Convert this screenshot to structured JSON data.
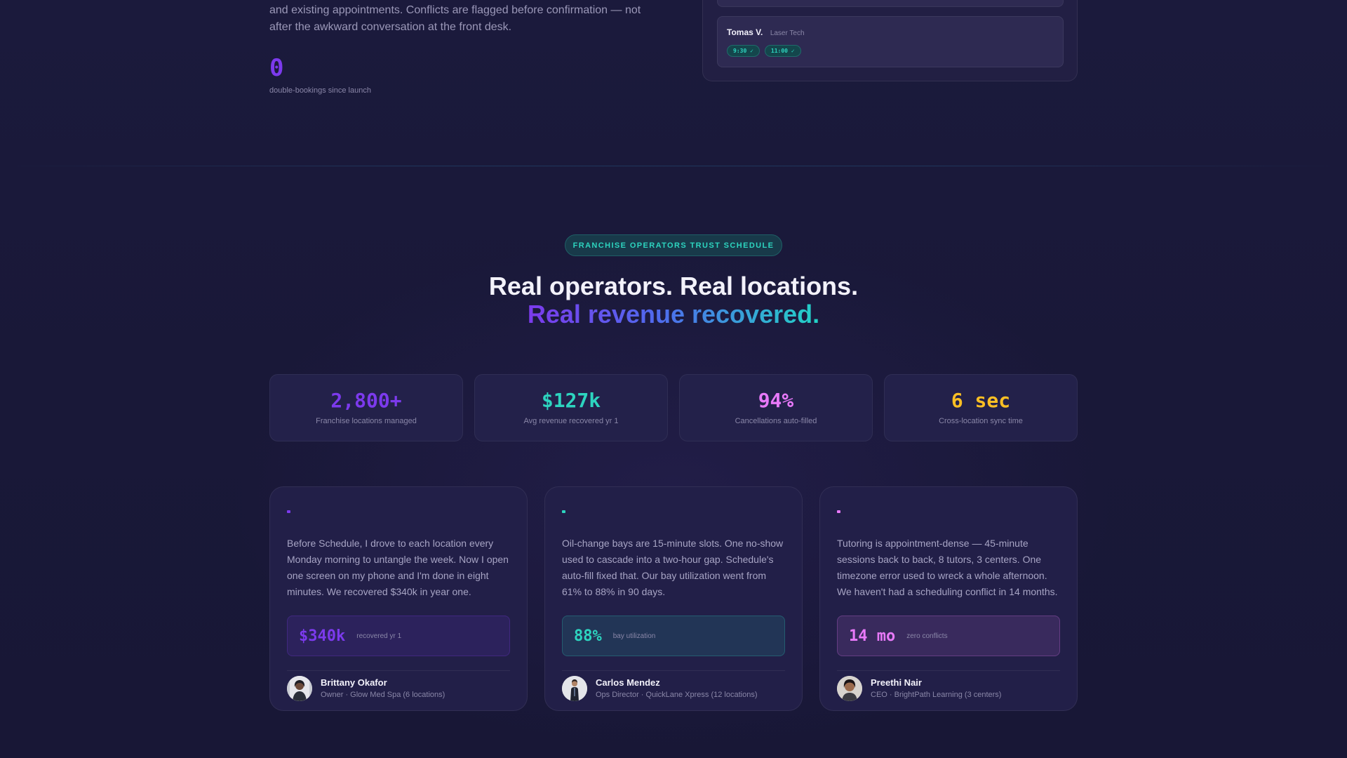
{
  "top": {
    "description": "and existing appointments. Conflicts are flagged before confirmation — not after the awkward conversation at the front desk.",
    "stat_value": "0",
    "stat_caption": "double-bookings since launch",
    "schedule": {
      "staff_name": "Tomas V.",
      "staff_role": "Laser Tech",
      "slots": [
        "9:30 ✓",
        "11:00 ✓"
      ]
    }
  },
  "trust": {
    "badge": "FRANCHISE OPERATORS TRUST SCHEDULE",
    "headline_line1": "Real operators. Real locations.",
    "headline_line2": "Real revenue recovered.",
    "stats": [
      {
        "value": "2,800+",
        "label": "Franchise locations managed",
        "color": "#7c3aed"
      },
      {
        "value": "$127k",
        "label": "Avg revenue recovered yr 1",
        "color": "#2dd4bf"
      },
      {
        "value": "94%",
        "label": "Cancellations auto-filled",
        "color": "#e879f9"
      },
      {
        "value": "6 sec",
        "label": "Cross-location sync time",
        "color": "#fbbf24"
      }
    ],
    "testimonials": [
      {
        "quote": "Before Schedule, I drove to each location every Monday morning to untangle the week. Now I open one screen on my phone and I'm done in eight minutes. We recovered $340k in year one.",
        "metric_value": "$340k",
        "metric_label": "recovered yr 1",
        "accent": "#7c3aed",
        "name": "Brittany Okafor",
        "role": "Owner · Glow Med Spa (6 locations)"
      },
      {
        "quote": "Oil-change bays are 15-minute slots. One no-show used to cascade into a two-hour gap. Schedule's auto-fill fixed that. Our bay utilization went from 61% to 88% in 90 days.",
        "metric_value": "88%",
        "metric_label": "bay utilization",
        "accent": "#2dd4bf",
        "name": "Carlos Mendez",
        "role": "Ops Director · QuickLane Xpress (12 locations)"
      },
      {
        "quote": "Tutoring is appointment-dense — 45-minute sessions back to back, 8 tutors, 3 centers. One timezone error used to wreck a whole afternoon. We haven't had a scheduling conflict in 14 months.",
        "metric_value": "14 mo",
        "metric_label": "zero conflicts",
        "accent": "#e879f9",
        "name": "Preethi Nair",
        "role": "CEO · BrightPath Learning (3 centers)"
      }
    ]
  }
}
